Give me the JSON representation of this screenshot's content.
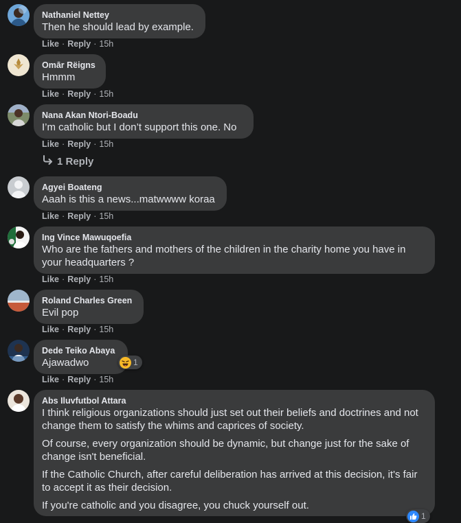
{
  "comments": [
    {
      "id": "c1",
      "name": "Nathaniel Nettey",
      "lines": [
        "Then he should lead by example."
      ],
      "like": "Like",
      "reply": "Reply",
      "time": "15h"
    },
    {
      "id": "c2",
      "name": "Omār Rëigns",
      "lines": [
        "Hmmm"
      ],
      "like": "Like",
      "reply": "Reply",
      "time": "15h"
    },
    {
      "id": "c3",
      "name": "Nana Akan Ntori-Boadu",
      "lines": [
        "I’m catholic but I don’t support this one. No"
      ],
      "like": "Like",
      "reply": "Reply",
      "time": "15h",
      "replies_label": "1 Reply"
    },
    {
      "id": "c4",
      "name": "Agyei Boateng",
      "lines": [
        "Aaah is this a news...matwwww koraa"
      ],
      "like": "Like",
      "reply": "Reply",
      "time": "15h"
    },
    {
      "id": "c5",
      "name": "Ing Vince Mawuqoefia",
      "lines": [
        "Who are the fathers and mothers of the children in the charity home you have in your headquarters ?"
      ],
      "like": "Like",
      "reply": "Reply",
      "time": "15h"
    },
    {
      "id": "c6",
      "name": "Roland Charles Green",
      "lines": [
        "Evil pop"
      ],
      "like": "Like",
      "reply": "Reply",
      "time": "15h"
    },
    {
      "id": "c7",
      "name": "Dede Teiko Abaya",
      "lines": [
        "Ajawadwo"
      ],
      "like": "Like",
      "reply": "Reply",
      "time": "15h",
      "reaction": {
        "icon": "haha-emoji-icon",
        "count": "1"
      }
    },
    {
      "id": "c8",
      "name": "Abs Iluvfutbol Attara",
      "lines": [
        "I think religious organizations should just set out their beliefs and doctrines and not change them to satisfy the whims and caprices of society.",
        "Of course, every organization should be dynamic, but change just for the sake of change isn't beneficial.",
        "If the Catholic Church, after careful deliberation has arrived at this decision, it's fair to accept it as their decision.",
        "If you're catholic and you disagree, you chuck yourself out."
      ],
      "reaction": {
        "icon": "like-icon",
        "count": "1"
      }
    }
  ],
  "colors": {
    "background": "#18191a",
    "bubble": "#3a3b3c",
    "text": "#e4e6eb",
    "secondary": "#b0b3b8",
    "like_blue": "#2d88ff",
    "haha_yellow": "#f7b928"
  }
}
